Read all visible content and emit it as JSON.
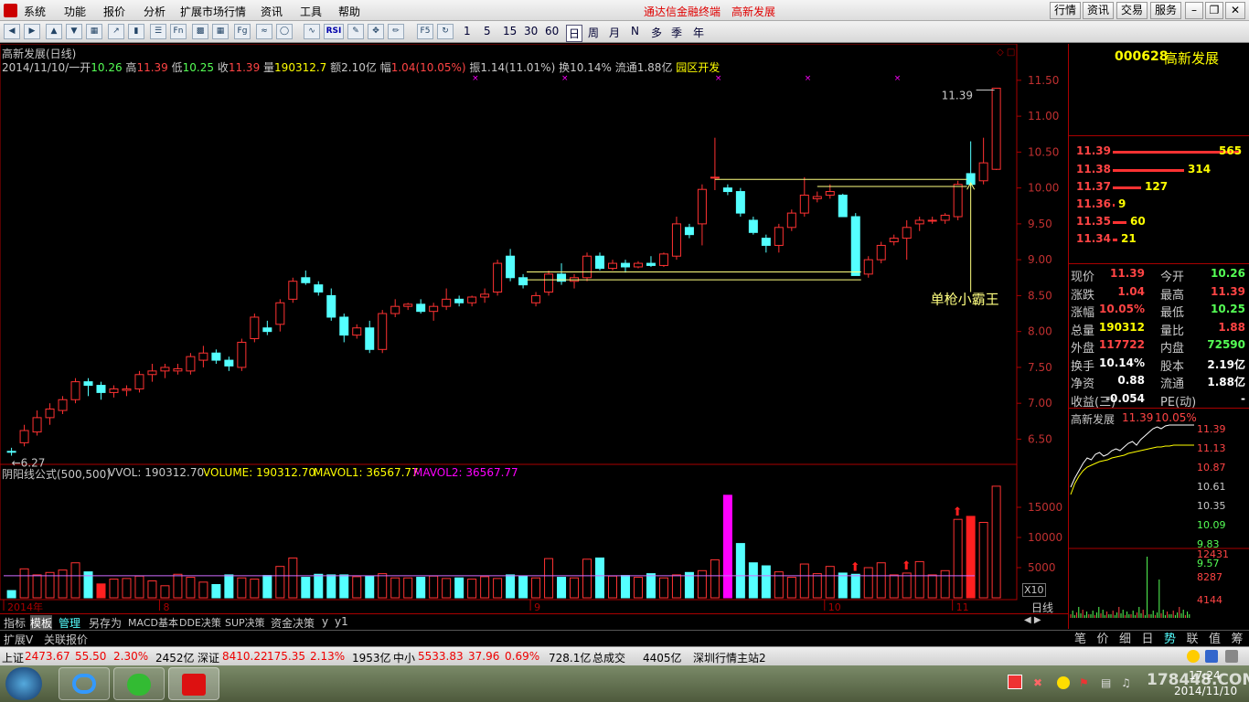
{
  "menu": {
    "items": [
      "系统",
      "功能",
      "报价",
      "分析",
      "扩展市场行情",
      "资讯",
      "工具",
      "帮助"
    ],
    "title1": "通达信金融终端",
    "title2": "高新发展",
    "right_buttons": [
      "行情",
      "资讯",
      "交易",
      "服务"
    ]
  },
  "toolbar": {
    "periods": [
      "F5",
      "1",
      "5",
      "15",
      "30",
      "60",
      "日",
      "周",
      "月",
      "N",
      "多",
      "季",
      "年"
    ],
    "rsi": "RSI",
    "fn": "Fn",
    "fg": "Fg"
  },
  "header": {
    "name": "高新发展(日线)",
    "date": "2014/11/10/一",
    "open_label": "开",
    "open": "10.26",
    "high_label": "高",
    "high": "11.39",
    "low_label": "低",
    "low": "10.25",
    "close_label": "收",
    "close": "11.39",
    "vol_label": "量",
    "vol": "190312.7",
    "amount_label": "额",
    "amount": "2.10亿",
    "change_label": "幅",
    "change": "1.04(10.05%)",
    "amp_label": "振",
    "amp": "1.14(11.01%)",
    "turnover_label": "换",
    "turnover": "10.14%",
    "float_label": "流通",
    "float": "1.88亿",
    "sector": "园区开发"
  },
  "annotations": {
    "high_mark": "11.39",
    "low_mark": "6.27",
    "callout": "单枪小霸王"
  },
  "volume_header": {
    "formula": "阴阳线公式(500,500)",
    "vvol": "VVOL: 190312.70",
    "volume": "VOLUME: 190312.70",
    "mavol1": "MAVOL1: 36567.77",
    "mavol2": "MAVOL2: 36567.77",
    "x10": "X10"
  },
  "date_axis": [
    "2014年",
    "8",
    "9",
    "10",
    "11"
  ],
  "price_axis": [
    "11.50",
    "11.00",
    "10.50",
    "10.00",
    "9.50",
    "9.00",
    "8.50",
    "8.00",
    "7.50",
    "7.00",
    "6.50"
  ],
  "vol_axis": [
    "15000",
    "10000",
    "5000"
  ],
  "bottom_tabs": [
    "指标",
    "模板",
    "管理",
    "另存为",
    "MACD基本",
    "DDE决策",
    "SUP决策",
    "资金决策",
    "y",
    "y1"
  ],
  "ext_bar": {
    "expand": "扩展V",
    "related": "关联报价",
    "rightlabel": "日线"
  },
  "panel": {
    "code": "000628",
    "name": "高新发展",
    "asks": [
      {
        "p": "11.39",
        "v": "565"
      }
    ],
    "bids": [
      {
        "p": "11.38",
        "v": "314"
      },
      {
        "p": "11.37",
        "v": "127"
      },
      {
        "p": "11.36",
        "v": "9"
      },
      {
        "p": "11.35",
        "v": "60"
      },
      {
        "p": "11.34",
        "v": "21"
      }
    ],
    "quote": [
      {
        "l1": "现价",
        "v1": "11.39",
        "l2": "今开",
        "v2": "10.26"
      },
      {
        "l1": "涨跌",
        "v1": "1.04",
        "l2": "最高",
        "v2": "11.39"
      },
      {
        "l1": "涨幅",
        "v1": "10.05%",
        "l2": "最低",
        "v2": "10.25"
      },
      {
        "l1": "总量",
        "v1": "190312",
        "l2": "量比",
        "v2": "1.88"
      },
      {
        "l1": "外盘",
        "v1": "117722",
        "l2": "内盘",
        "v2": "72590"
      },
      {
        "l1": "换手",
        "v1": "10.14%",
        "l2": "股本",
        "v2": "2.19亿"
      },
      {
        "l1": "净资",
        "v1": "0.88",
        "l2": "流通",
        "v2": "1.88亿"
      },
      {
        "l1": "收益(三)",
        "v1": "-0.054",
        "l2": "PE(动)",
        "v2": "-"
      }
    ],
    "mini_title": "高新发展",
    "mini_price": "11.39",
    "mini_pct": "10.05%",
    "mini_axis": [
      "11.39",
      "11.13",
      "10.87",
      "10.61",
      "10.35",
      "10.09",
      "9.83",
      "9.57",
      "12431",
      "8287",
      "4144"
    ],
    "tabs": [
      "笔",
      "价",
      "细",
      "日",
      "势",
      "联",
      "值",
      "筹"
    ]
  },
  "status": {
    "sh_label": "上证",
    "sh": "2473.67",
    "sh_chg": "55.50",
    "sh_pct": "2.30%",
    "sh_amt": "2452亿",
    "sz_label": "深证",
    "sz": "8410.22",
    "sz_chg": "175.35",
    "sz_pct": "2.13%",
    "sz_amt": "1953亿",
    "zx_label": "中小",
    "zx": "5533.83",
    "zx_chg": "37.96",
    "zx_pct": "0.69%",
    "zx_amt": "728.1亿",
    "total_label": "总成交",
    "total": "4405亿",
    "server": "深圳行情主站2"
  },
  "taskbar": {
    "clock": "17:24",
    "date": "2014/11/10",
    "watermark": "178448.COM"
  },
  "chart_data": {
    "type": "candlestick",
    "ylim": [
      6.2,
      11.6
    ],
    "vol_ylim": [
      0,
      20000
    ],
    "ohlc": [
      [
        6.33,
        6.38,
        6.27,
        6.32
      ],
      [
        6.45,
        6.7,
        6.4,
        6.62
      ],
      [
        6.6,
        6.9,
        6.55,
        6.8
      ],
      [
        6.8,
        7.0,
        6.7,
        6.92
      ],
      [
        6.9,
        7.1,
        6.85,
        7.05
      ],
      [
        7.05,
        7.35,
        7.0,
        7.3
      ],
      [
        7.3,
        7.35,
        7.1,
        7.25
      ],
      [
        7.25,
        7.3,
        7.05,
        7.15
      ],
      [
        7.15,
        7.25,
        7.08,
        7.2
      ],
      [
        7.18,
        7.25,
        7.1,
        7.2
      ],
      [
        7.2,
        7.45,
        7.15,
        7.4
      ],
      [
        7.4,
        7.55,
        7.3,
        7.45
      ],
      [
        7.45,
        7.55,
        7.35,
        7.5
      ],
      [
        7.45,
        7.55,
        7.4,
        7.48
      ],
      [
        7.45,
        7.7,
        7.4,
        7.65
      ],
      [
        7.6,
        7.8,
        7.5,
        7.7
      ],
      [
        7.7,
        7.75,
        7.55,
        7.6
      ],
      [
        7.6,
        7.65,
        7.45,
        7.52
      ],
      [
        7.5,
        7.9,
        7.45,
        7.85
      ],
      [
        7.9,
        8.25,
        7.85,
        8.2
      ],
      [
        8.05,
        8.15,
        7.95,
        8.0
      ],
      [
        8.1,
        8.45,
        8.0,
        8.4
      ],
      [
        8.45,
        8.75,
        8.4,
        8.7
      ],
      [
        8.75,
        8.85,
        8.65,
        8.68
      ],
      [
        8.65,
        8.7,
        8.5,
        8.55
      ],
      [
        8.5,
        8.6,
        8.15,
        8.2
      ],
      [
        8.2,
        8.25,
        7.85,
        7.95
      ],
      [
        7.95,
        8.1,
        7.9,
        8.05
      ],
      [
        8.05,
        8.15,
        7.7,
        7.75
      ],
      [
        7.75,
        8.3,
        7.7,
        8.25
      ],
      [
        8.25,
        8.45,
        8.2,
        8.35
      ],
      [
        8.35,
        8.4,
        8.3,
        8.38
      ],
      [
        8.38,
        8.45,
        8.25,
        8.28
      ],
      [
        8.28,
        8.4,
        8.15,
        8.35
      ],
      [
        8.35,
        8.6,
        8.3,
        8.45
      ],
      [
        8.45,
        8.5,
        8.35,
        8.4
      ],
      [
        8.4,
        8.5,
        8.35,
        8.48
      ],
      [
        8.48,
        8.6,
        8.4,
        8.52
      ],
      [
        8.55,
        9.0,
        8.5,
        8.95
      ],
      [
        9.05,
        9.15,
        8.7,
        8.75
      ],
      [
        8.75,
        8.8,
        8.6,
        8.65
      ],
      [
        8.4,
        8.55,
        8.35,
        8.5
      ],
      [
        8.55,
        8.85,
        8.5,
        8.8
      ],
      [
        8.8,
        8.95,
        8.65,
        8.7
      ],
      [
        8.7,
        8.8,
        8.6,
        8.75
      ],
      [
        8.75,
        9.1,
        8.7,
        9.05
      ],
      [
        9.05,
        9.1,
        8.85,
        8.88
      ],
      [
        8.88,
        9.0,
        8.85,
        8.95
      ],
      [
        8.95,
        9.0,
        8.82,
        8.9
      ],
      [
        8.9,
        8.98,
        8.88,
        8.95
      ],
      [
        8.95,
        9.05,
        8.9,
        8.92
      ],
      [
        8.92,
        9.1,
        8.9,
        9.08
      ],
      [
        9.05,
        9.6,
        9.0,
        9.5
      ],
      [
        9.45,
        9.5,
        9.3,
        9.35
      ],
      [
        9.5,
        10.05,
        9.2,
        9.98
      ],
      [
        10.15,
        10.7,
        9.97,
        10.15
      ],
      [
        10.0,
        10.05,
        9.9,
        9.95
      ],
      [
        9.95,
        10.0,
        9.6,
        9.65
      ],
      [
        9.55,
        9.6,
        9.35,
        9.38
      ],
      [
        9.3,
        9.35,
        9.1,
        9.2
      ],
      [
        9.2,
        9.5,
        9.1,
        9.45
      ],
      [
        9.45,
        9.7,
        9.4,
        9.65
      ],
      [
        9.65,
        10.15,
        9.6,
        9.9
      ],
      [
        9.85,
        9.95,
        9.8,
        9.88
      ],
      [
        9.9,
        10.05,
        9.85,
        9.95
      ],
      [
        9.9,
        9.92,
        9.6,
        9.6
      ],
      [
        9.6,
        9.65,
        8.95,
        8.78
      ],
      [
        8.8,
        9.05,
        8.75,
        9.0
      ],
      [
        9.0,
        9.25,
        8.95,
        9.2
      ],
      [
        9.25,
        9.35,
        9.2,
        9.3
      ],
      [
        9.3,
        9.55,
        9.0,
        9.45
      ],
      [
        9.5,
        9.6,
        9.4,
        9.55
      ],
      [
        9.55,
        9.6,
        9.5,
        9.55
      ],
      [
        9.55,
        9.65,
        9.5,
        9.62
      ],
      [
        9.6,
        10.1,
        9.55,
        10.05
      ],
      [
        10.2,
        10.65,
        10.0,
        10.05
      ],
      [
        10.1,
        10.7,
        10.05,
        10.35
      ],
      [
        10.26,
        11.39,
        10.25,
        11.39
      ]
    ],
    "volume": [
      1200,
      4800,
      3800,
      4200,
      4600,
      5800,
      4300,
      2300,
      3100,
      3200,
      3600,
      2800,
      2000,
      3900,
      3400,
      2600,
      2200,
      3800,
      3300,
      3100,
      3700,
      5200,
      6600,
      3400,
      3900,
      3800,
      3800,
      3500,
      3600,
      4000,
      3300,
      3300,
      3400,
      3600,
      3200,
      3300,
      3100,
      3500,
      3200,
      3800,
      3600,
      3300,
      6500,
      3400,
      3300,
      6400,
      6600,
      3600,
      3700,
      3400,
      4000,
      3300,
      3800,
      4200,
      4500,
      6300,
      17000,
      9000,
      5800,
      5300,
      4300,
      3400,
      5600,
      4000,
      5200,
      4100,
      3900,
      5000,
      5800,
      3800,
      4100,
      6000,
      3800,
      4500,
      13000,
      13500,
      12500,
      18500
    ],
    "up_color": "#ff3232",
    "down_color": "#54ffff"
  }
}
